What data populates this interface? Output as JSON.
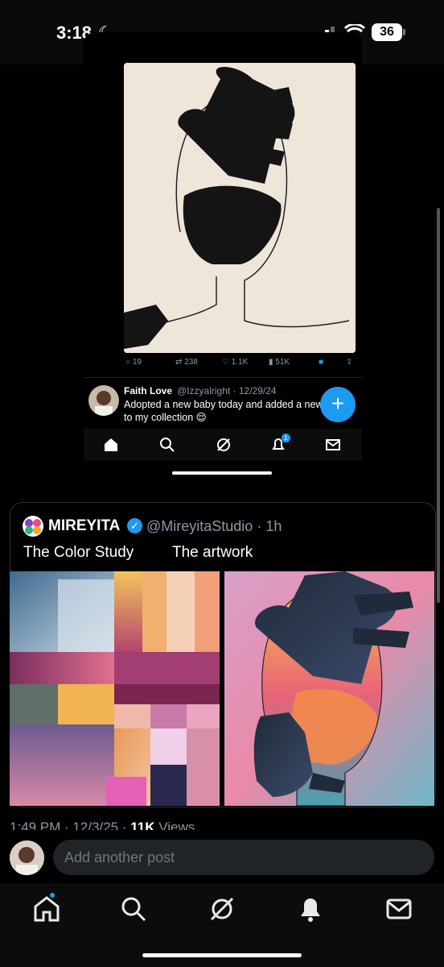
{
  "status_bar": {
    "time": "3:18",
    "battery": "36"
  },
  "embedded_screenshot": {
    "actions": {
      "replies": "19",
      "reposts": "238",
      "likes": "1.1K",
      "views": "51K"
    },
    "post": {
      "name": "Faith Love",
      "handle": "@Izzyalright · 12/29/24",
      "text": "Adopted a new baby today and added a new to my collection 😌"
    },
    "fab_label": "+",
    "notification_count": "1"
  },
  "quoted_post": {
    "display_name": "MIREYITA",
    "handle": "@MireyitaStudio · 1h",
    "caption_left": "The Color Study",
    "caption_right": "The artwork"
  },
  "meta": {
    "timestamp": "1:49 PM · 12/3/25 · ",
    "views_count": "11K",
    "views_label": " Views"
  },
  "reply": {
    "placeholder": "Add another post"
  },
  "colors": {
    "accent": "#1d9bf0",
    "background": "#000000",
    "muted": "#8b98a5"
  },
  "nav": {
    "items": [
      "home-icon",
      "search-icon",
      "grok-icon",
      "notifications-icon",
      "messages-icon"
    ]
  }
}
